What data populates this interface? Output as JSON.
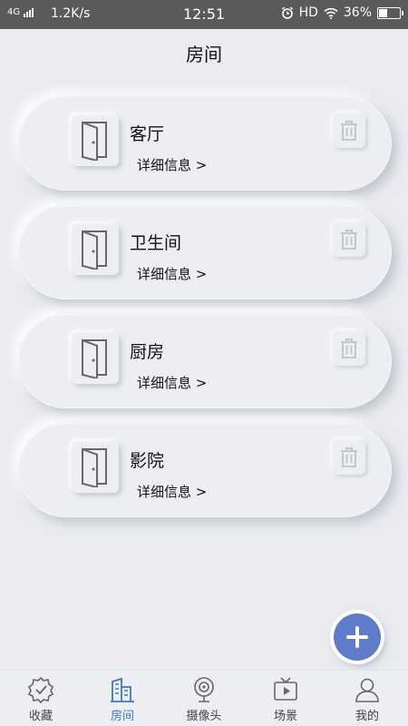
{
  "status_bar": {
    "network": "4G",
    "speed": "1.2K/s",
    "time": "12:51",
    "hd": "HD",
    "battery": "36%",
    "battery_level": 0.36
  },
  "header": {
    "title": "房间"
  },
  "rooms": [
    {
      "name": "客厅",
      "detail": "详细信息 >"
    },
    {
      "name": "卫生间",
      "detail": "详细信息 >"
    },
    {
      "name": "厨房",
      "detail": "详细信息 >"
    },
    {
      "name": "影院",
      "detail": "详细信息 >"
    }
  ],
  "nav": [
    {
      "label": "收藏",
      "icon": "badge-check-icon"
    },
    {
      "label": "房间",
      "icon": "building-icon",
      "active": true
    },
    {
      "label": "摄像头",
      "icon": "camera-icon"
    },
    {
      "label": "场景",
      "icon": "tv-play-icon"
    },
    {
      "label": "我的",
      "icon": "person-icon"
    }
  ],
  "colors": {
    "accent": "#3a78c9",
    "fab": "#5f7ccb",
    "background": "#e9ebef"
  }
}
